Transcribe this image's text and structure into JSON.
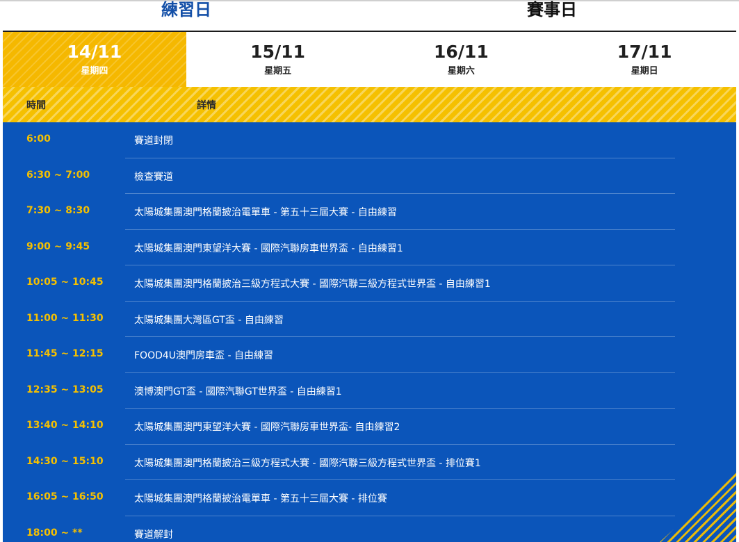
{
  "header": {
    "practice_label": "練習日",
    "race_label": "賽事日"
  },
  "days": [
    {
      "date": "14/11",
      "weekday": "星期四",
      "active": true
    },
    {
      "date": "15/11",
      "weekday": "星期五",
      "active": false
    },
    {
      "date": "16/11",
      "weekday": "星期六",
      "active": false
    },
    {
      "date": "17/11",
      "weekday": "星期日",
      "active": false
    }
  ],
  "columns": {
    "time": "時間",
    "detail": "詳情"
  },
  "schedule": [
    {
      "time": "6:00",
      "detail": "賽道封閉"
    },
    {
      "time": "6:30 ~ 7:00",
      "detail": "檢查賽道"
    },
    {
      "time": "7:30 ~ 8:30",
      "detail": "太陽城集團澳門格蘭披治電單車 - 第五十三屆大賽 - 自由練習"
    },
    {
      "time": "9:00 ~ 9:45",
      "detail": "太陽城集團澳門東望洋大賽 - 國際汽聯房車世界盃 - 自由練習1"
    },
    {
      "time": "10:05 ~ 10:45",
      "detail": "太陽城集團澳門格蘭披治三級方程式大賽 - 國際汽聯三級方程式世界盃 - 自由練習1"
    },
    {
      "time": "11:00 ~ 11:30",
      "detail": "太陽城集團大灣區GT盃 - 自由練習"
    },
    {
      "time": "11:45 ~ 12:15",
      "detail": "FOOD4U澳門房車盃 - 自由練習"
    },
    {
      "time": "12:35 ~ 13:05",
      "detail": "澳博澳門GT盃 - 國際汽聯GT世界盃 - 自由練習1"
    },
    {
      "time": "13:40 ~ 14:10",
      "detail": "太陽城集團澳門東望洋大賽 - 國際汽聯房車世界盃- 自由練習2"
    },
    {
      "time": "14:30 ~ 15:10",
      "detail": "太陽城集團澳門格蘭披治三級方程式大賽 - 國際汽聯三級方程式世界盃 - 排位賽1"
    },
    {
      "time": "16:05 ~ 16:50",
      "detail": "太陽城集團澳門格蘭披治電單車 - 第五十三屆大賽 - 排位賽"
    },
    {
      "time": "18:00 ~ **",
      "detail": "賽道解封"
    }
  ],
  "colors": {
    "accent_yellow": "#f5c000",
    "schedule_blue": "#0b55ba",
    "header_blue": "#1450a8"
  }
}
